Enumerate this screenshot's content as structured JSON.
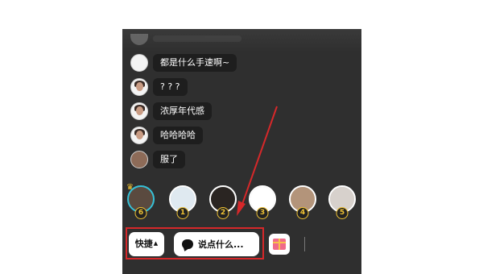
{
  "comments": [
    {
      "text": "都是什么手速啊~",
      "avatar": "plain"
    },
    {
      "text": "? ? ?",
      "avatar": "face"
    },
    {
      "text": "浓厚年代感",
      "avatar": "face"
    },
    {
      "text": "哈哈哈哈",
      "avatar": "face"
    },
    {
      "text": "服了",
      "avatar": "brown"
    }
  ],
  "ranking": [
    {
      "rank": "6",
      "color": "#5a4a3f"
    },
    {
      "rank": "1",
      "color": "#dfe9f0"
    },
    {
      "rank": "2",
      "color": "#2a2522"
    },
    {
      "rank": "3",
      "color": "#ffffff"
    },
    {
      "rank": "4",
      "color": "#b3947a"
    },
    {
      "rank": "5",
      "color": "#d7d1cc"
    }
  ],
  "bottom_bar": {
    "quick_label": "快捷",
    "say_placeholder": "说点什么...",
    "gift_icon": "gift-icon",
    "chat_icon": "chat-bubble-icon"
  },
  "annotation": {
    "box_color": "#d6282a",
    "arrow_color": "#d6282a"
  }
}
